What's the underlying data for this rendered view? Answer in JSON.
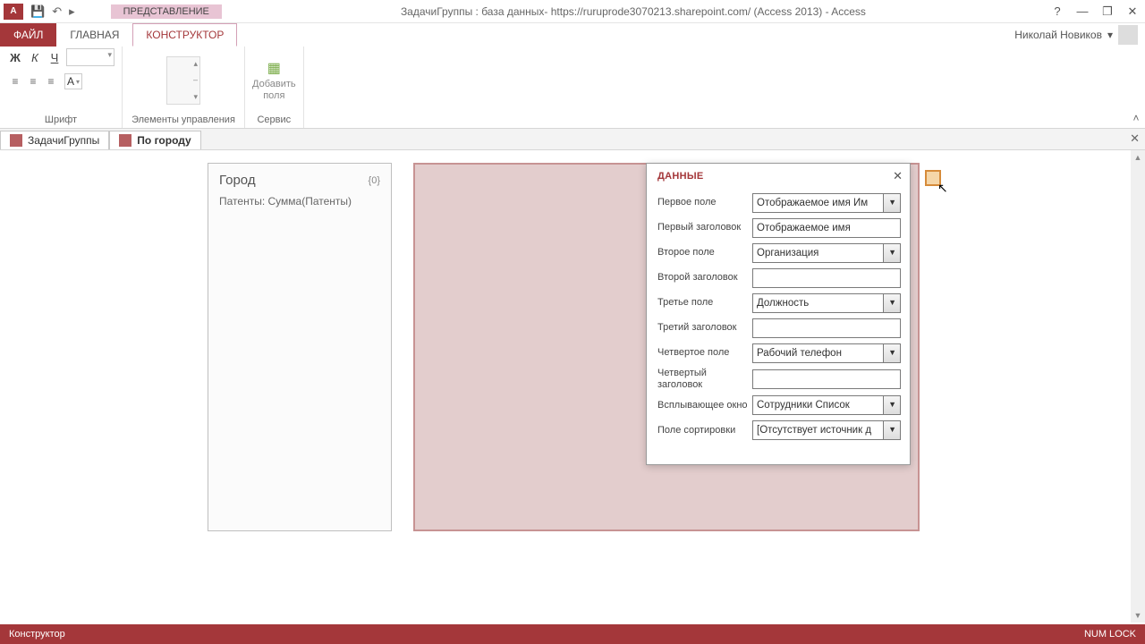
{
  "titlebar": {
    "contextual_label": "ПРЕДСТАВЛЕНИЕ",
    "title": "ЗадачиГруппы : база данных- https://ruruprode3070213.sharepoint.com/ (Access 2013) - Access"
  },
  "menu": {
    "file": "ФАЙЛ",
    "home": "ГЛАВНАЯ",
    "design": "КОНСТРУКТОР",
    "user": "Николай Новиков"
  },
  "ribbon": {
    "bold": "Ж",
    "italic": "К",
    "underline": "Ч",
    "fontcolor_label": "A",
    "group_font": "Шрифт",
    "group_controls": "Элементы управления",
    "service_button": "Добавить\nполя",
    "group_service": "Сервис"
  },
  "objtabs": {
    "t1": "ЗадачиГруппы",
    "t2": "По городу"
  },
  "canvas": {
    "group_header": "Город",
    "group_count": "{0}",
    "group_sub": "Патенты: Сумма(Патенты)"
  },
  "dialog": {
    "title": "ДАННЫЕ",
    "rows": {
      "r1_label": "Первое поле",
      "r1_value": "Отображаемое имя Им",
      "r2_label": "Первый заголовок",
      "r2_value": "Отображаемое имя",
      "r3_label": "Второе поле",
      "r3_value": "Организация",
      "r4_label": "Второй заголовок",
      "r4_value": "",
      "r5_label": "Третье поле",
      "r5_value": "Должность",
      "r6_label": "Третий заголовок",
      "r6_value": "",
      "r7_label": "Четвертое поле",
      "r7_value": "Рабочий телефон",
      "r8_label": "Четвертый заголовок",
      "r8_value": "",
      "r9_label": "Всплывающее окно",
      "r9_value": "Сотрудники Список",
      "r10_label": "Поле сортировки",
      "r10_value": "[Отсутствует источник д"
    }
  },
  "status": {
    "left": "Конструктор",
    "right": "NUM LOCK"
  }
}
